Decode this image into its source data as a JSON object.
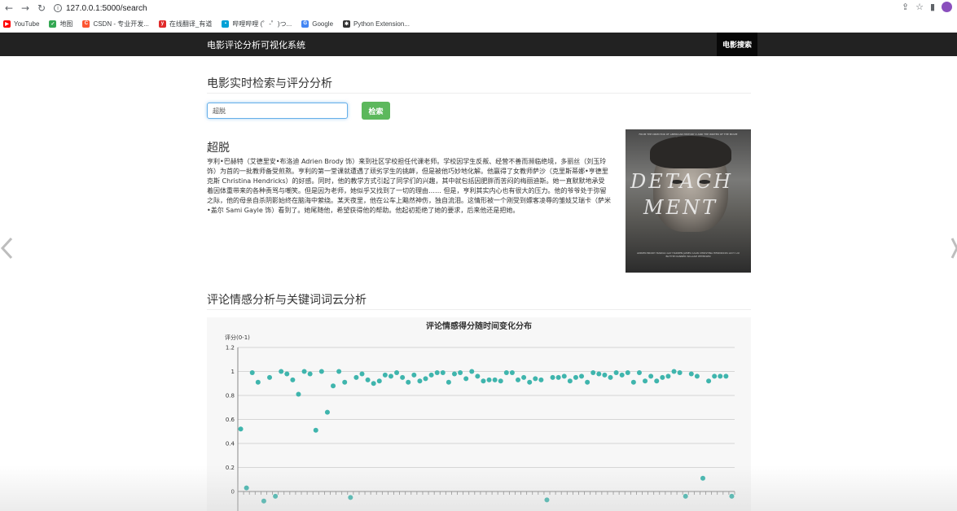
{
  "browser": {
    "url": "127.0.0.1:5000/search",
    "bookmarks": [
      {
        "label": "YouTube",
        "color": "#ff0000"
      },
      {
        "label": "地图",
        "color": "#34a853"
      },
      {
        "label": "CSDN - 专业开发...",
        "color": "#fc5531"
      },
      {
        "label": "在线翻译_有道",
        "color": "#e02a2a"
      },
      {
        "label": "哔哩哔哩 (゜-゜)つ...",
        "color": "#00a1d6"
      },
      {
        "label": "Google",
        "color": "#4285f4"
      },
      {
        "label": "Python Extension...",
        "color": "#333333"
      }
    ]
  },
  "navbar": {
    "brand": "电影评论分析可视化系统",
    "link": "电影搜索"
  },
  "search": {
    "heading": "电影实时检索与评分分析",
    "value": "超脱",
    "button": "检索"
  },
  "movie": {
    "title": "超脱",
    "description": "亨利•巴赫特（艾德里安•布洛迪 Adrien Brody 饰）来到社区学校担任代课老师。学校因学生反叛、经营不善而濒临绝境，多丽丝（刘玉玲 饰）为首的一批教师备受煎熬。亨利的第一堂课就遭遇了顽劣学生的挑衅，但是被他巧妙地化解。他赢得了女教师萨沙（克里斯蒂娜•亨德里克斯 Christina Hendricks）的好感。同时，他的教学方式引起了同学们的兴趣，其中就包括因肥胖而苦闷的梅丽迪斯。她一直默默地承受着因体重带来的各种责骂与嘲笑。但是因为老师，她似乎又找到了一切的理由…… 但是，亨利其实内心也有很大的压力。他的爷爷处于弥留之际，他的母亲自杀阴影始终在脑海中萦绕。某天夜里，他在公车上黯然神伤，独自流泪。这情形被一个刚受到嫖客凌辱的雏妓艾瑞卡（萨米•盖尔 Sami Gayle 饰）看到了。她尾随他，希望获得他的帮助。他起初拒绝了她的要求，后来他还是把她。",
    "poster_title_1": "DETACH",
    "poster_title_2": "MENT",
    "poster_top_text": "FROM THE DIRECTOR OF AMERICAN HISTORY X AND THE WRITER OF THE MOVIE \"THE HURT LOCKER\"",
    "poster_bottom_text": "ADRIEN BRODY   MARCIA GAY HARDEN   JAMES CAAN   CHRISTINA HENDRICKS   LUCY LIU   BLYTHE DANNER   WILLIAM PETERSEN"
  },
  "analysis": {
    "heading": "评论情感分析与关键词词云分析"
  },
  "chart_data": {
    "type": "scatter",
    "title": "评论情感得分随时间变化分布",
    "ylabel": "评分(0-1)",
    "ylim": [
      0,
      1.2
    ],
    "yticks": [
      "0",
      "0.2",
      "0.4",
      "0.6",
      "0.8",
      "1",
      "1.2"
    ],
    "color": "#3fb5ad",
    "series": [
      {
        "values": [
          0.52,
          0.03,
          0.99,
          0.91,
          -0.08,
          0.95,
          -0.04,
          1.0,
          0.98,
          0.93,
          0.81,
          1.0,
          0.98,
          0.51,
          1.0,
          0.66,
          0.88,
          1.0,
          0.91,
          -0.05,
          0.95,
          0.98,
          0.93,
          0.9,
          0.92,
          0.97,
          0.96,
          0.99,
          0.95,
          0.91,
          0.97,
          0.92,
          0.94,
          0.97,
          0.99,
          0.99,
          0.91,
          0.98,
          0.99,
          0.94,
          1.0,
          0.96,
          0.92,
          0.93,
          0.93,
          0.92,
          0.99,
          0.99,
          0.93,
          0.95,
          0.91,
          0.94,
          0.93,
          -0.07,
          0.95,
          0.95,
          0.96,
          0.92,
          0.95,
          0.96,
          0.91,
          0.99,
          0.98,
          0.97,
          0.95,
          0.99,
          0.97,
          0.99,
          0.91,
          0.99,
          0.92,
          0.96,
          0.92,
          0.95,
          0.96,
          1.0,
          0.99,
          -0.04,
          0.98,
          0.96,
          0.11,
          0.92,
          0.96,
          0.96,
          0.96,
          -0.04
        ]
      }
    ]
  }
}
